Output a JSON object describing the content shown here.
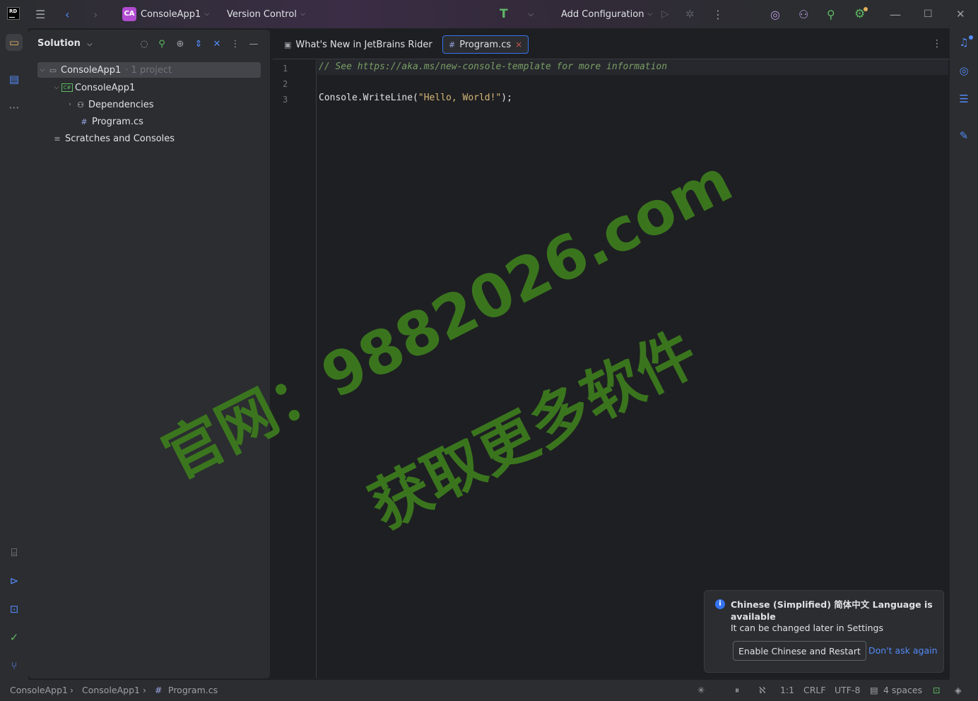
{
  "titlebar": {
    "project_badge": "CA",
    "project_name": "ConsoleApp1",
    "version_control": "Version Control",
    "add_configuration": "Add Configuration"
  },
  "solution": {
    "title": "Solution",
    "tree": [
      {
        "label": "ConsoleApp1",
        "suffix": "1 project"
      },
      {
        "label": "ConsoleApp1",
        "badge": "C#"
      },
      {
        "label": "Dependencies"
      },
      {
        "label": "Program.cs"
      },
      {
        "label": "Scratches and Consoles"
      }
    ]
  },
  "editor": {
    "tabs": [
      {
        "label": "What's New in JetBrains Rider"
      },
      {
        "label": "Program.cs"
      }
    ],
    "line_numbers": [
      "1",
      "2",
      "3"
    ],
    "code": {
      "line1_comment": "// See https://aka.ms/new-console-template for more information",
      "line3_pre": "Console.WriteLine(",
      "line3_str": "\"Hello, World!\"",
      "line3_post": ");"
    }
  },
  "watermark": {
    "line1": "官网：9882026.com",
    "line2": "获取更多软件"
  },
  "notification": {
    "title": "Chinese (Simplified) 简体中文 Language is available",
    "body": "It can be changed later in Settings",
    "primary_button": "Enable Chinese and Restart",
    "link": "Don't ask again"
  },
  "statusbar": {
    "breadcrumbs": [
      "ConsoleApp1",
      "ConsoleApp1",
      "Program.cs"
    ],
    "position": "1:1",
    "line_ending": "CRLF",
    "encoding": "UTF-8",
    "indent": "4 spaces"
  },
  "colors": {
    "accent": "#3574f0",
    "badge": "#b14cd1",
    "watermark": "#3c7a1e"
  }
}
